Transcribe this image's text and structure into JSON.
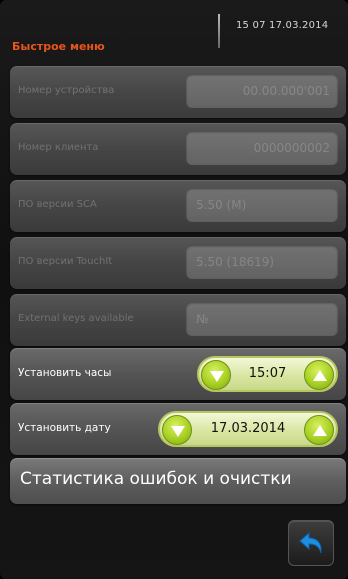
{
  "header": {
    "title": "Быстрое меню",
    "clock": "15 07  17.03.2014"
  },
  "rows": [
    {
      "label": "Номер устройства",
      "value": "00.00.000'001"
    },
    {
      "label": "Номер клиента",
      "value": "0000000002"
    },
    {
      "label": "ПО версии SCA",
      "value": "5.50 (M)"
    },
    {
      "label": "ПО версии TouchIt",
      "value": "5.50 (18619)"
    },
    {
      "label": "External keys available",
      "value": "№"
    }
  ],
  "set_time": {
    "label": "Установить часы",
    "value": "15:07"
  },
  "set_date": {
    "label": "Установить дату",
    "value": "17.03.2014"
  },
  "stats_button": {
    "label": "Статистика ошибок и очистки"
  },
  "icons": {
    "down": "chevron-down-icon",
    "up": "chevron-up-icon",
    "back": "back-arrow-icon"
  },
  "colors": {
    "title_accent": "#e8541c",
    "stepper_green": "#a8d123",
    "back_arrow_blue": "#1e8fe0"
  }
}
